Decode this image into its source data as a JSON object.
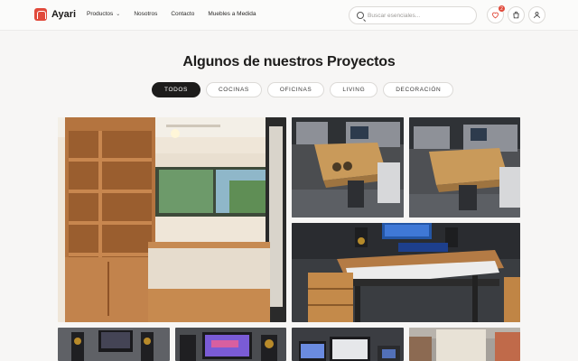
{
  "brand": {
    "name": "Ayari",
    "accent": "#e14a3b"
  },
  "nav": {
    "items": [
      {
        "label": "Productos",
        "has_dropdown": true
      },
      {
        "label": "Nosotros"
      },
      {
        "label": "Contacto"
      },
      {
        "label": "Muebles a Medida"
      }
    ]
  },
  "search": {
    "placeholder": "Buscar esenciales...",
    "icon": "search-icon"
  },
  "header_actions": {
    "favorites": {
      "icon": "heart-icon",
      "count": "2"
    },
    "cart": {
      "icon": "bag-icon"
    },
    "account": {
      "icon": "user-icon"
    }
  },
  "page": {
    "title": "Algunos de nuestros Proyectos"
  },
  "filters": {
    "selected": "TODOS",
    "items": [
      "TODOS",
      "COCINAS",
      "OFICINAS",
      "LIVING",
      "DECORACIÓN"
    ]
  },
  "gallery": {
    "tiles": [
      {
        "id": "wood-study-room"
      },
      {
        "id": "coffee-table-top"
      },
      {
        "id": "coffee-table-side"
      },
      {
        "id": "piano-desk"
      },
      {
        "id": "studio-speakers"
      },
      {
        "id": "studio-monitor"
      },
      {
        "id": "desk-screens"
      },
      {
        "id": "stone-wall"
      }
    ]
  }
}
